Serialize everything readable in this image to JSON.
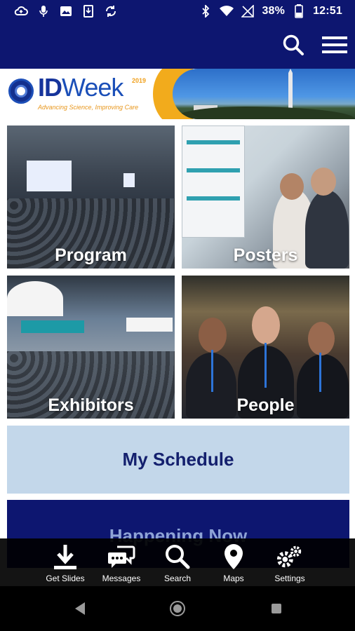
{
  "status_bar": {
    "battery_percent": "38%",
    "time": "12:51",
    "left_icons": [
      "cloud-upload-icon",
      "microphone-icon",
      "image-icon",
      "download-icon",
      "sync-icon"
    ],
    "right_icons": [
      "bluetooth-icon",
      "wifi-icon",
      "no-signal-icon",
      "battery-icon"
    ]
  },
  "header": {
    "icons": [
      "search-icon",
      "hamburger-menu-icon"
    ],
    "background": "#0d1670"
  },
  "banner": {
    "brand_id": "ID",
    "brand_week": "Week",
    "year": "2019",
    "tagline": "Advancing Science, Improving Care"
  },
  "tiles": [
    {
      "label": "Program"
    },
    {
      "label": "Posters"
    },
    {
      "label": "Exhibitors"
    },
    {
      "label": "People"
    }
  ],
  "buttons": {
    "my_schedule": "My Schedule",
    "happening_now": "Happening Now"
  },
  "tabbar": {
    "items": [
      {
        "label": "Get Slides",
        "icon": "download-icon"
      },
      {
        "label": "Messages",
        "icon": "chat-bubbles-icon"
      },
      {
        "label": "Search",
        "icon": "search-icon"
      },
      {
        "label": "Maps",
        "icon": "map-pin-icon"
      },
      {
        "label": "Settings",
        "icon": "gears-icon"
      }
    ]
  },
  "navbar": {
    "icons": [
      "back-icon",
      "home-icon",
      "recents-icon"
    ]
  },
  "colors": {
    "primary": "#0d1670",
    "schedule_bg": "#c3d7ea",
    "schedule_text": "#14206e",
    "accent": "#f2ab1c"
  }
}
